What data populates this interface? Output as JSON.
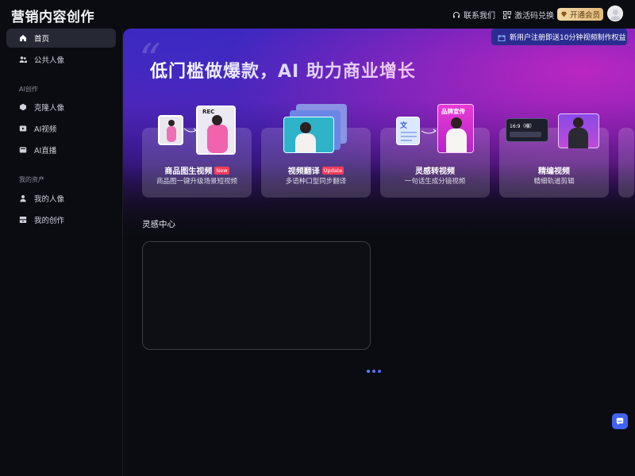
{
  "app": {
    "logo_text": "营销内容创作"
  },
  "header": {
    "contact_label": "联系我们",
    "redeem_label": "激活码兑换",
    "vip_label": "开通会员",
    "promo_text": "新用户注册即送10分钟视频制作权益"
  },
  "sidebar": {
    "items": [
      {
        "label": "首页",
        "icon": "home-icon",
        "active": true
      },
      {
        "label": "公共人像",
        "icon": "users-icon"
      }
    ],
    "sections": [
      {
        "title": "AI创作",
        "items": [
          {
            "label": "克隆人像",
            "icon": "clone-icon"
          },
          {
            "label": "AI视频",
            "icon": "video-icon"
          },
          {
            "label": "AI直播",
            "icon": "live-icon"
          }
        ]
      },
      {
        "title": "我的资产",
        "items": [
          {
            "label": "我的人像",
            "icon": "person-icon"
          },
          {
            "label": "我的创作",
            "icon": "archive-icon"
          }
        ]
      }
    ]
  },
  "hero": {
    "title": "低门槛做爆款，AI 助力商业增长",
    "cards": [
      {
        "title": "商品图生视频",
        "badge": "New",
        "subtitle": "商品图一键升级场景短视频",
        "art_label": "REC"
      },
      {
        "title": "视频翻译",
        "badge": "Update",
        "subtitle": "多语种口型同步翻译"
      },
      {
        "title": "灵感转视频",
        "subtitle": "一句话生成分镜视频",
        "art_label": "品牌宣传",
        "doc_glyph": "文"
      },
      {
        "title": "精编视频",
        "subtitle": "精细轨道剪辑",
        "art_label": "16:9（横）"
      }
    ]
  },
  "inspiration": {
    "title": "灵感中心"
  },
  "colors": {
    "accent_blue": "#3f63f2",
    "promo_bg": "#2a2d8f",
    "vip_gold": "#e2b977",
    "badge_red": "#ff3d5c"
  }
}
